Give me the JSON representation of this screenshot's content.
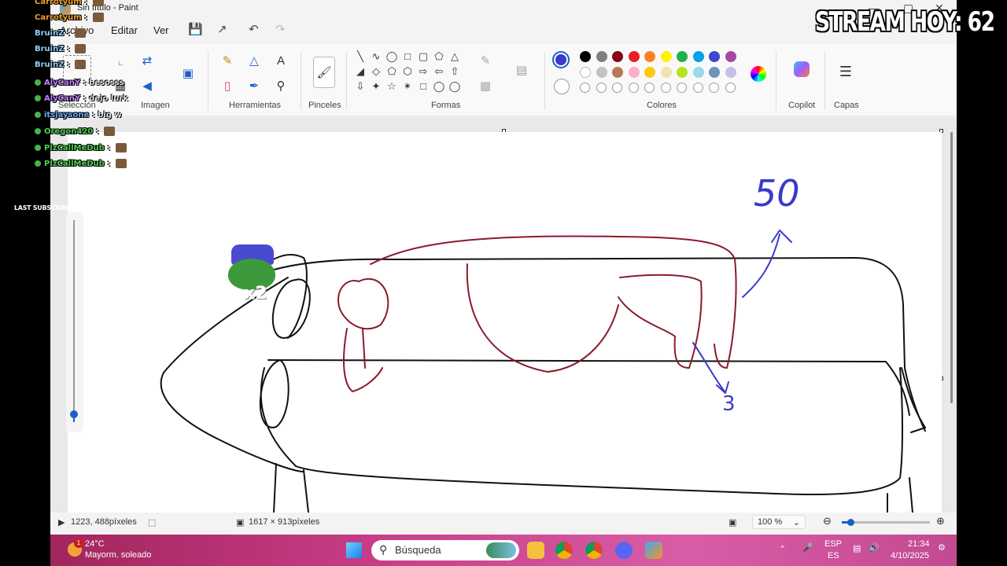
{
  "window": {
    "title": "Sin título - Paint",
    "minimize": "—",
    "maximize": "▢",
    "close": "✕"
  },
  "menu": {
    "file": "Archivo",
    "edit": "Editar",
    "view": "Ver"
  },
  "ribbon": {
    "groups": {
      "selection": "Selección",
      "image": "Imagen",
      "tools": "Herramientas",
      "brushes": "Pinceles",
      "shapes": "Formas",
      "colors": "Colores",
      "copilot": "Copilot",
      "layers": "Capas"
    },
    "active_color": "#3a3ac8",
    "palette_row1": [
      "#000000",
      "#7f7f7f",
      "#880015",
      "#ed1c24",
      "#ff7f27",
      "#fff200",
      "#22b14c",
      "#00a2e8",
      "#3f48cc",
      "#a349a4"
    ],
    "palette_row2": [
      "#ffffff",
      "#c3c3c3",
      "#b97a57",
      "#ffaec9",
      "#ffc90e",
      "#efe4b0",
      "#b5e61d",
      "#99d9ea",
      "#7092be",
      "#c8bfe7"
    ]
  },
  "canvas": {
    "label_fifty": "50",
    "label_three": "3",
    "emote_text": "x2"
  },
  "status": {
    "cursor_pos": "1223, 488píxeles",
    "canvas_size": "1617 × 913píxeles",
    "zoom": "100 %",
    "zoom_level": 0.1
  },
  "taskbar": {
    "temp": "24°C",
    "weather": "Mayorm. soleado",
    "weather_alert": "1",
    "search_placeholder": "Búsqueda",
    "lang_top": "ESP",
    "lang_bottom": "ES",
    "time": "21:34",
    "date": "4/10/2025"
  },
  "overlay": {
    "stream_counter": "STREAM HOY: 62",
    "last_subscriber": "LAST SUBSCRIBER: LadyAlli",
    "chat": [
      {
        "user": "Carrotyum",
        "text": "",
        "color": "#f0a030"
      },
      {
        "user": "Carrotyum",
        "text": "",
        "color": "#f0a030"
      },
      {
        "user": "BruinZ",
        "text": "",
        "color": "#8fd0ff"
      },
      {
        "user": "BruinZ",
        "text": "",
        "color": "#8fd0ff"
      },
      {
        "user": "BruinZ",
        "text": "",
        "color": "#8fd0ff"
      },
      {
        "user": "AlyCanY",
        "text": "besosss",
        "color": "#c080ff"
      },
      {
        "user": "AlyCanY",
        "text": "dejo lurk",
        "color": "#c080ff"
      },
      {
        "user": "itsjaysone",
        "text": "big w",
        "color": "#6aa8ff"
      },
      {
        "user": "Oregon420",
        "text": "",
        "color": "#4fd04f"
      },
      {
        "user": "PlzCallMeDub",
        "text": "",
        "color": "#4fd04f"
      },
      {
        "user": "PlzCallMeDub",
        "text": "",
        "color": "#4fd04f"
      }
    ]
  }
}
